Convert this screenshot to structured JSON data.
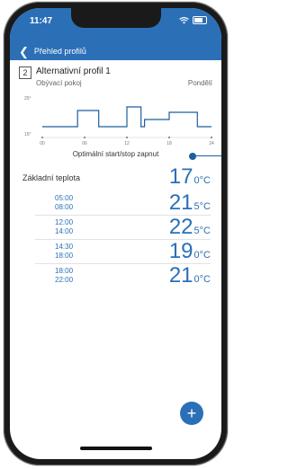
{
  "status": {
    "time": "11:47",
    "wifi_icon": "wifi-icon",
    "battery_icon": "battery-icon"
  },
  "nav": {
    "back_label": "Přehled profilů"
  },
  "profile": {
    "number": "2",
    "name": "Alternativní profil 1",
    "room": "Obývací pokoj",
    "day": "Pondělí"
  },
  "chart_data": {
    "type": "line",
    "y_ticks": [
      "25°",
      "15°"
    ],
    "x_ticks": [
      "00",
      "06",
      "12",
      "18",
      "24"
    ],
    "x": [
      0,
      5,
      5,
      8,
      8,
      12,
      12,
      14,
      14,
      14.5,
      14.5,
      18,
      18,
      22,
      22,
      24
    ],
    "y": [
      17,
      17,
      21.5,
      21.5,
      17,
      17,
      22.5,
      22.5,
      17,
      17,
      19,
      19,
      21,
      21,
      17,
      17
    ],
    "ylim": [
      15,
      25
    ],
    "xlim": [
      0,
      24
    ],
    "color": "#1b5e9f"
  },
  "optimum": {
    "label": "Optimální start/stop zapnut"
  },
  "base": {
    "label": "Základní teplota",
    "whole": "17",
    "decimal": "0°C"
  },
  "periods": [
    {
      "start": "05:00",
      "end": "08:00",
      "whole": "21",
      "decimal": "5°C"
    },
    {
      "start": "12:00",
      "end": "14:00",
      "whole": "22",
      "decimal": "5°C"
    },
    {
      "start": "14:30",
      "end": "18:00",
      "whole": "19",
      "decimal": "0°C"
    },
    {
      "start": "18:00",
      "end": "22:00",
      "whole": "21",
      "decimal": "0°C"
    }
  ],
  "fab": {
    "icon": "plus-icon",
    "label": "+"
  },
  "colors": {
    "accent": "#2b6fb6",
    "dark_accent": "#1b5e9f"
  }
}
